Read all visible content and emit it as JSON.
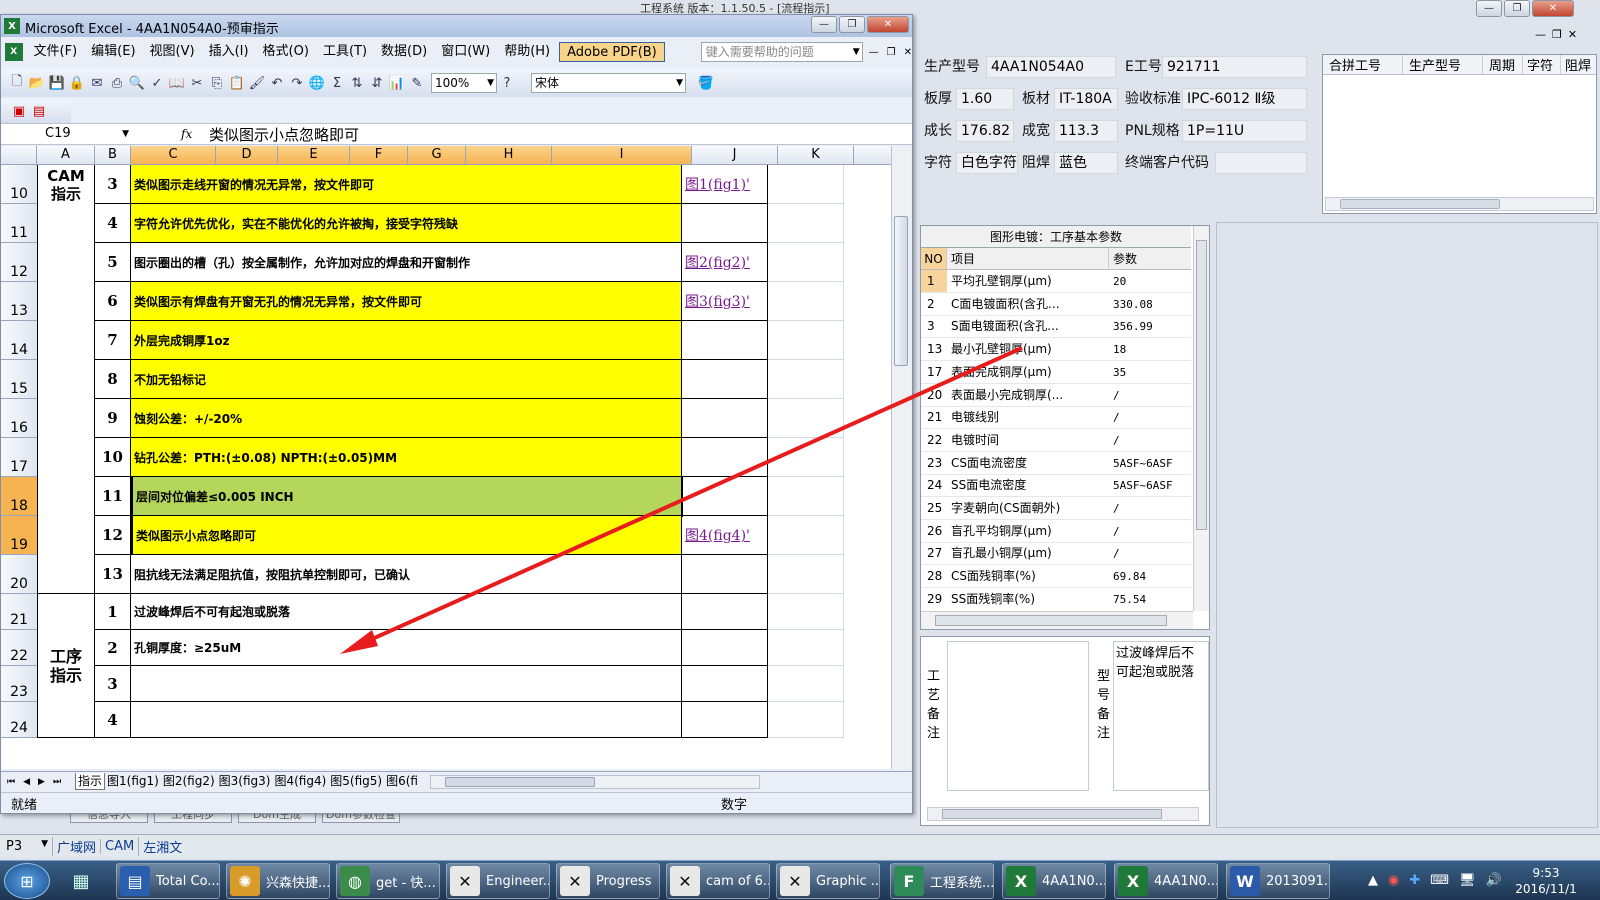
{
  "bg_app": {
    "title": "工程系统 版本：1.1.50.5 - [流程指示]",
    "info": [
      {
        "label": "生产型号",
        "value": "4AA1N054A0"
      },
      {
        "label": "E工号",
        "value": "921711"
      },
      {
        "label": "板厚",
        "value": "1.60"
      },
      {
        "label": "板材",
        "value": "IT-180A"
      },
      {
        "label": "验收标准",
        "value": "IPC-6012 Ⅱ级"
      },
      {
        "label": "成长",
        "value": "176.82"
      },
      {
        "label": "成宽",
        "value": "113.3"
      },
      {
        "label": "PNL规格",
        "value": "1P=11U"
      },
      {
        "label": "字符",
        "value": "白色字符"
      },
      {
        "label": "阻焊",
        "value": "蓝色"
      },
      {
        "label": "终端客户代码",
        "value": ""
      }
    ],
    "merge_table": {
      "headers": [
        "合拼工号",
        "生产型号",
        "周期",
        "字符",
        "阻焊"
      ]
    },
    "param_panel": {
      "title": "图形电镀：工序基本参数",
      "headers": [
        "NO",
        "项目",
        "参数"
      ],
      "rows": [
        {
          "no": "1",
          "item": "平均孔壁铜厚(μm)",
          "val": "20"
        },
        {
          "no": "2",
          "item": "C面电镀面积(含孔...",
          "val": "330.08"
        },
        {
          "no": "3",
          "item": "S面电镀面积(含孔...",
          "val": "356.99"
        },
        {
          "no": "13",
          "item": "最小孔壁铜厚(μm)",
          "val": "18"
        },
        {
          "no": "17",
          "item": "表面完成铜厚(μm)",
          "val": "35"
        },
        {
          "no": "20",
          "item": "表面最小完成铜厚(...",
          "val": "/"
        },
        {
          "no": "21",
          "item": "电镀线别",
          "val": "/"
        },
        {
          "no": "22",
          "item": "电镀时间",
          "val": "/"
        },
        {
          "no": "23",
          "item": "CS面电流密度",
          "val": "5ASF~6ASF"
        },
        {
          "no": "24",
          "item": "SS面电流密度",
          "val": "5ASF~6ASF"
        },
        {
          "no": "25",
          "item": "字麦朝向(CS面朝外)",
          "val": "/"
        },
        {
          "no": "26",
          "item": "盲孔平均铜厚(μm)",
          "val": "/"
        },
        {
          "no": "27",
          "item": "盲孔最小铜厚(μm)",
          "val": "/"
        },
        {
          "no": "28",
          "item": "CS面残铜率(%)",
          "val": "69.84"
        },
        {
          "no": "29",
          "item": "SS面残铜率(%)",
          "val": "75.54"
        }
      ]
    },
    "remarks": {
      "process_label": "工艺备注",
      "model_label": "型号备注",
      "model_text": "过波峰焊后不可起泡或脱落"
    },
    "bottom_buttons": [
      "信息导入",
      "工程同步",
      "Dom生成",
      "Dom参数检查"
    ],
    "status_left": "P3",
    "status_items": [
      "广域网",
      "CAM",
      "左湘文"
    ]
  },
  "excel": {
    "title": "Microsoft Excel - 4AA1N054A0-预审指示",
    "menus": [
      "文件(F)",
      "编辑(E)",
      "视图(V)",
      "插入(I)",
      "格式(O)",
      "工具(T)",
      "数据(D)",
      "窗口(W)",
      "帮助(H)"
    ],
    "adobe_menu": "Adobe PDF(B)",
    "help_placeholder": "键入需要帮助的问题",
    "zoom": "100%",
    "font_name": "宋体",
    "namebox": "C19",
    "fx": "fx",
    "formula": "类似图示小点忽略即可",
    "columns": [
      "A",
      "B",
      "C",
      "D",
      "E",
      "F",
      "G",
      "H",
      "I",
      "J",
      "K"
    ],
    "group_cam": "CAM\n指示",
    "group_proc": "工序\n指示",
    "rows": [
      {
        "row": "10",
        "num": "3",
        "text": "类似图示走线开窗的情况无异常，按文件即可",
        "link": "图1(fig1)'",
        "fill": "yellow"
      },
      {
        "row": "11",
        "num": "4",
        "text": "字符允许优先优化，实在不能优化的允许被掏，接受字符残缺",
        "link": "",
        "fill": "yellow"
      },
      {
        "row": "12",
        "num": "5",
        "text": "图示圈出的槽（孔）按全属制作，允许加对应的焊盘和开窗制作",
        "link": "图2(fig2)'",
        "fill": "white"
      },
      {
        "row": "13",
        "num": "6",
        "text": "类似图示有焊盘有开窗无孔的情况无异常，按文件即可",
        "link": "图3(fig3)'",
        "fill": "yellow"
      },
      {
        "row": "14",
        "num": "7",
        "text": "外层完成铜厚1oz",
        "link": "",
        "fill": "yellow"
      },
      {
        "row": "15",
        "num": "8",
        "text": "不加无铅标记",
        "link": "",
        "fill": "yellow"
      },
      {
        "row": "16",
        "num": "9",
        "text": "蚀刻公差：+/-20%",
        "link": "",
        "fill": "yellow"
      },
      {
        "row": "17",
        "num": "10",
        "text": "钻孔公差：PTH:(±0.08) NPTH:(±0.05)MM",
        "link": "",
        "fill": "yellow"
      },
      {
        "row": "18",
        "num": "11",
        "text": "层间对位偏差≤0.005 INCH",
        "link": "",
        "fill": "green"
      },
      {
        "row": "19",
        "num": "12",
        "text": "类似图示小点忽略即可",
        "link": "图4(fig4)'",
        "fill": "yellow"
      },
      {
        "row": "20",
        "num": "13",
        "text": "阻抗线无法满足阻抗值，按阻抗单控制即可，已确认",
        "link": "",
        "fill": "white"
      },
      {
        "row": "21",
        "num": "1",
        "text": "过波峰焊后不可有起泡或脱落",
        "link": "",
        "fill": "white"
      },
      {
        "row": "22",
        "num": "2",
        "text": "孔铜厚度：≥25uM",
        "link": "",
        "fill": "white"
      },
      {
        "row": "23",
        "num": "3",
        "text": "",
        "link": "",
        "fill": "white"
      },
      {
        "row": "24",
        "num": "4",
        "text": "",
        "link": "",
        "fill": "white"
      }
    ],
    "sheet_tabs": [
      "指示",
      "图1(fig1)",
      "图2(fig2)",
      "图3(fig3)",
      "图4(fig4)",
      "图5(fig5)",
      "图6(fi"
    ],
    "status_ready": "就绪",
    "status_mode": "数字"
  },
  "taskbar": {
    "items": [
      "Total Co...",
      "兴森快捷...",
      "get - 快...",
      "Engineer...",
      "Progress",
      "cam of 6...",
      "Graphic ...",
      "工程系统...",
      "4AA1N0...",
      "4AA1N0...",
      "2013091..."
    ],
    "time": "9:53",
    "date": "2016/11/1"
  },
  "colors": {
    "yellow": "#ffff00",
    "green": "#b3d65b",
    "arrow": "#e81c1c",
    "selected_header": "#f6b352"
  }
}
